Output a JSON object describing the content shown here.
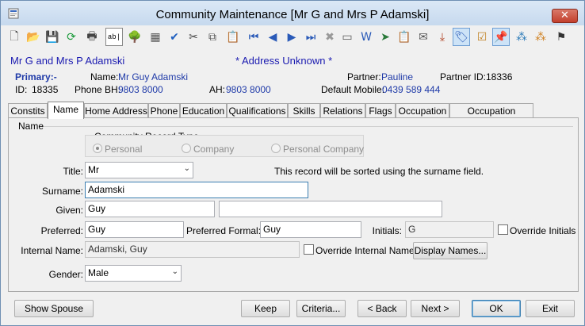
{
  "window": {
    "title": "Community Maintenance  [Mr G and Mrs P Adamski]",
    "close_symbol": "✕"
  },
  "toolbar": {
    "buttons": [
      {
        "name": "new-icon",
        "glyph": "🗋",
        "color": "#333"
      },
      {
        "name": "open-folder-icon",
        "glyph": "📂",
        "color": "#d8a323"
      },
      {
        "name": "save-icon",
        "glyph": "💾",
        "color": "#9a9a9a"
      },
      {
        "name": "refresh-icon",
        "glyph": "⟳",
        "color": "#1a9a3a"
      },
      {
        "name": "print-icon",
        "glyph": "🖶",
        "color": "#444"
      },
      {
        "name": "text-field-icon",
        "glyph": "ab|",
        "color": "#000"
      },
      {
        "name": "tree-icon",
        "glyph": "🌳",
        "color": "#2e8b2e"
      },
      {
        "name": "calculator-icon",
        "glyph": "▦",
        "color": "#555"
      },
      {
        "name": "spellcheck-icon",
        "glyph": "✔",
        "color": "#2060c0"
      },
      {
        "name": "cut-icon",
        "glyph": "✂",
        "color": "#444"
      },
      {
        "name": "copy-icon",
        "glyph": "⧉",
        "color": "#555"
      },
      {
        "name": "paste-icon",
        "glyph": "📋",
        "color": "#b0762a"
      },
      {
        "name": "first-record-icon",
        "glyph": "⏮",
        "color": "#2a5ab8"
      },
      {
        "name": "previous-record-icon",
        "glyph": "◀",
        "color": "#2a5ab8"
      },
      {
        "name": "next-record-icon",
        "glyph": "▶",
        "color": "#2a5ab8"
      },
      {
        "name": "last-record-icon",
        "glyph": "⏭",
        "color": "#2a5ab8"
      },
      {
        "name": "delete-icon",
        "glyph": "✖",
        "color": "#999"
      },
      {
        "name": "card-icon",
        "glyph": "▭",
        "color": "#555"
      },
      {
        "name": "word-document-icon",
        "glyph": "W",
        "color": "#2a5ab8"
      },
      {
        "name": "send-icon",
        "glyph": "➤",
        "color": "#2a7a3a"
      },
      {
        "name": "clipboard-icon",
        "glyph": "📋",
        "color": "#666"
      },
      {
        "name": "mail-out-icon",
        "glyph": "✉",
        "color": "#555"
      },
      {
        "name": "download-icon",
        "glyph": "⤓",
        "color": "#b04020"
      },
      {
        "name": "tag-icon",
        "glyph": "🏷",
        "color": "#2a5ab8"
      },
      {
        "name": "checklist-icon",
        "glyph": "☑",
        "color": "#c08020"
      },
      {
        "name": "pin-icon",
        "glyph": "📌",
        "color": "#2a5ab8"
      },
      {
        "name": "group-icon",
        "glyph": "⁂",
        "color": "#2a7ab8"
      },
      {
        "name": "people-icon",
        "glyph": "⁂",
        "color": "#d08020"
      },
      {
        "name": "flag-icon",
        "glyph": "⚑",
        "color": "#333"
      }
    ]
  },
  "header": {
    "name": "Mr G and Mrs P Adamski",
    "address_status": "* Address Unknown *",
    "primary_label": "Primary:-",
    "name_label": "Name:",
    "name_value": "Mr Guy Adamski",
    "partner_label": "Partner:",
    "partner_value": "Pauline",
    "partner_id_label": "Partner ID:",
    "partner_id_value": "18336",
    "id_label": "ID:",
    "id_value": "18335",
    "phone_bh_label": "Phone BH:",
    "phone_bh_value": "9803 8000",
    "ah_label": "AH:",
    "ah_value": "9803 8000",
    "mobile_label": "Default Mobile:",
    "mobile_value": "0439 589 444"
  },
  "tabs": [
    "Constits",
    "Name",
    "Home Address",
    "Phone",
    "Education",
    "Qualifications",
    "Skills",
    "Relations",
    "Flags",
    "Occupation",
    "Occupation Address"
  ],
  "form": {
    "group_title": "Name",
    "record_type": {
      "title": "Community Record Type",
      "options": [
        "Personal",
        "Company",
        "Personal Company"
      ],
      "selected": "Personal"
    },
    "title_label": "Title:",
    "title_value": "Mr",
    "sort_note": "This record will be sorted using the surname field.",
    "surname_label": "Surname:",
    "surname_value": "Adamski",
    "given_label": "Given:",
    "given_value": "Guy",
    "given_extra_value": "",
    "preferred_label": "Preferred:",
    "preferred_value": "Guy",
    "preferred_formal_label": "Preferred Formal:",
    "preferred_formal_value": "Guy",
    "initials_label": "Initials:",
    "initials_value": "G",
    "override_initials_label": "Override Initials",
    "internal_name_label": "Internal Name:",
    "internal_name_value": "Adamski, Guy",
    "override_internal_label": "Override Internal Name",
    "display_names_button": "Display Names...",
    "gender_label": "Gender:",
    "gender_value": "Male"
  },
  "footer": {
    "show_spouse": "Show Spouse",
    "keep": "Keep",
    "criteria": "Criteria...",
    "back": "< Back",
    "next": "Next >",
    "ok": "OK",
    "exit": "Exit"
  }
}
